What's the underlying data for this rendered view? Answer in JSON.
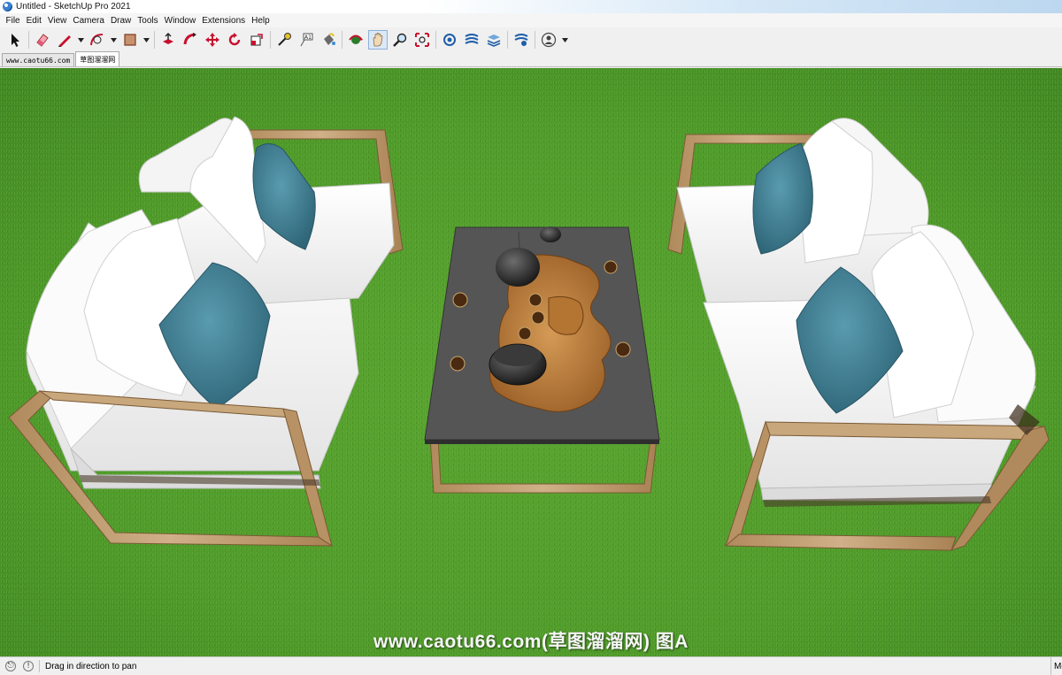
{
  "window": {
    "title": "Untitled - SketchUp Pro 2021"
  },
  "menu": [
    "File",
    "Edit",
    "View",
    "Camera",
    "Draw",
    "Tools",
    "Window",
    "Extensions",
    "Help"
  ],
  "toolbar": {
    "tools": [
      {
        "icon": "select-arrow-icon"
      },
      {
        "icon": "eraser-icon"
      },
      {
        "icon": "pencil-line-icon",
        "dropdown": true
      },
      {
        "icon": "arc-icon",
        "dropdown": true
      },
      {
        "icon": "rectangle-shape-icon",
        "dropdown": true
      },
      {
        "icon": "push-pull-icon"
      },
      {
        "icon": "follow-me-icon"
      },
      {
        "icon": "move-icon"
      },
      {
        "icon": "rotate-icon"
      },
      {
        "icon": "scale-icon"
      },
      {
        "icon": "tape-measure-icon"
      },
      {
        "icon": "text-icon"
      },
      {
        "icon": "paint-bucket-icon"
      },
      {
        "icon": "orbit-icon"
      },
      {
        "icon": "pan-hand-icon",
        "active": true
      },
      {
        "icon": "zoom-icon"
      },
      {
        "icon": "zoom-extents-icon"
      },
      {
        "icon": "3d-warehouse-icon"
      },
      {
        "icon": "extension-warehouse-icon"
      },
      {
        "icon": "layout-send-icon"
      },
      {
        "icon": "extension-manager-icon"
      },
      {
        "icon": "account-icon",
        "dropdown": true
      }
    ]
  },
  "tabs": [
    {
      "label": "www.caotu66.com",
      "active": false
    },
    {
      "label": "草图溜溜网",
      "active": true
    }
  ],
  "viewport": {
    "watermark": "www.caotu66.com(草图溜溜网) 图A",
    "colors": {
      "grass": "#4f9a2a",
      "frame": "#c9a77c",
      "cushion": "#f0f0f0",
      "pillow": "#3f7f95",
      "table_top": "#555555",
      "tea_tray": "#b87a3a"
    }
  },
  "status": {
    "icons": [
      "geo-location-icon",
      "info-icon"
    ],
    "text": "Drag in direction to pan",
    "measurements_label": "Me"
  }
}
